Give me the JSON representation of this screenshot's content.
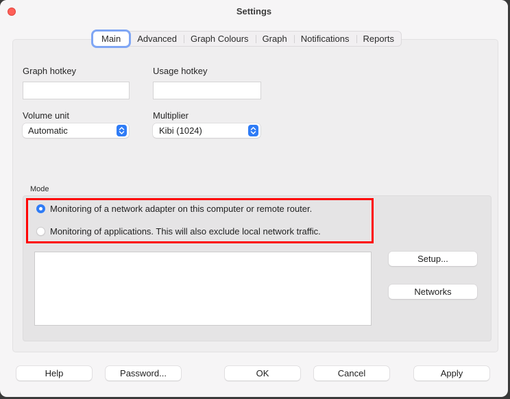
{
  "window": {
    "title": "Settings"
  },
  "tabs": [
    {
      "label": "Main",
      "active": true
    },
    {
      "label": "Advanced",
      "active": false
    },
    {
      "label": "Graph Colours",
      "active": false
    },
    {
      "label": "Graph",
      "active": false
    },
    {
      "label": "Notifications",
      "active": false
    },
    {
      "label": "Reports",
      "active": false
    }
  ],
  "main": {
    "graph_hotkey": {
      "label": "Graph hotkey",
      "value": ""
    },
    "usage_hotkey": {
      "label": "Usage hotkey",
      "value": ""
    },
    "volume_unit": {
      "label": "Volume unit",
      "selected": "Automatic"
    },
    "multiplier": {
      "label": "Multiplier",
      "selected": "Kibi (1024)"
    },
    "mode": {
      "label": "Mode",
      "options": [
        {
          "label": "Monitoring of a network adapter on this computer or remote router.",
          "selected": true
        },
        {
          "label": "Monitoring of applications. This will also exclude local network traffic.",
          "selected": false
        }
      ],
      "list_items": [],
      "setup_label": "Setup...",
      "networks_label": "Networks"
    }
  },
  "footer": {
    "help_label": "Help",
    "password_label": "Password...",
    "ok_label": "OK",
    "cancel_label": "Cancel",
    "apply_label": "Apply"
  },
  "colors": {
    "accent": "#2f7cf6",
    "close_button": "#fe5f57",
    "highlight_annotation": "#ff0000"
  }
}
